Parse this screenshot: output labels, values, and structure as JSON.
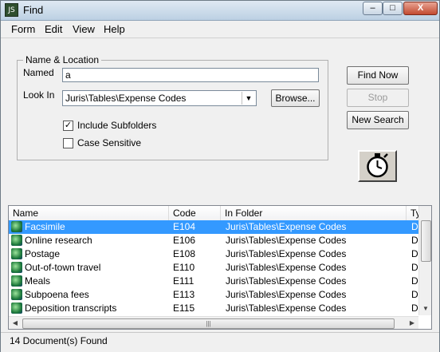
{
  "window": {
    "title": "Find",
    "app_icon": "app-icon"
  },
  "titlebar_buttons": {
    "minimize": "–",
    "maximize": "□",
    "close": "X"
  },
  "menu": [
    "Form",
    "Edit",
    "View",
    "Help"
  ],
  "group": {
    "legend": "Name & Location"
  },
  "named": {
    "label": "Named",
    "value": "a"
  },
  "lookin": {
    "label": "Look In",
    "value": "Juris\\Tables\\Expense Codes"
  },
  "browse_label": "Browse...",
  "include_subfolders": {
    "label": "Include Subfolders",
    "checked": true
  },
  "case_sensitive": {
    "label": "Case Sensitive",
    "checked": false
  },
  "buttons": {
    "find_now": "Find Now",
    "stop": "Stop",
    "new_search": "New Search"
  },
  "list": {
    "columns": [
      "Name",
      "Code",
      "In Folder",
      "Ty"
    ],
    "rows": [
      {
        "name": "Facsimile",
        "code": "E104",
        "folder": "Juris\\Tables\\Expense Codes",
        "type": "Do",
        "selected": true
      },
      {
        "name": "Online research",
        "code": "E106",
        "folder": "Juris\\Tables\\Expense Codes",
        "type": "Do",
        "selected": false
      },
      {
        "name": "Postage",
        "code": "E108",
        "folder": "Juris\\Tables\\Expense Codes",
        "type": "Do",
        "selected": false
      },
      {
        "name": "Out-of-town travel",
        "code": "E110",
        "folder": "Juris\\Tables\\Expense Codes",
        "type": "Do",
        "selected": false
      },
      {
        "name": "Meals",
        "code": "E111",
        "folder": "Juris\\Tables\\Expense Codes",
        "type": "Do",
        "selected": false
      },
      {
        "name": "Subpoena fees",
        "code": "E113",
        "folder": "Juris\\Tables\\Expense Codes",
        "type": "Do",
        "selected": false
      },
      {
        "name": "Deposition transcripts",
        "code": "E115",
        "folder": "Juris\\Tables\\Expense Codes",
        "type": "Do",
        "selected": false
      }
    ]
  },
  "status": "14 Document(s) Found",
  "colors": {
    "selection": "#3399ff",
    "window_bg": "#f0f0f0"
  }
}
